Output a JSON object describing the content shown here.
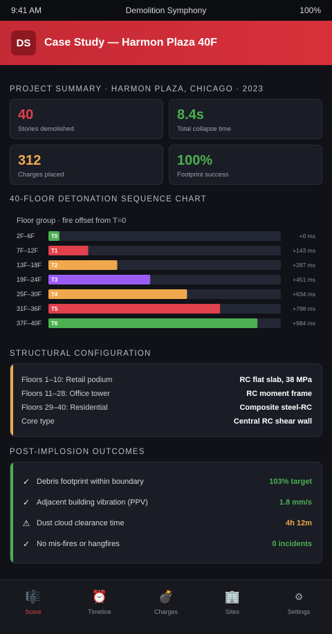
{
  "status": {
    "time": "9:41 AM",
    "app": "Demolition Symphony",
    "battery": "100%"
  },
  "header": {
    "badge": "DS",
    "title": "Case Study — Harmon Plaza 40F"
  },
  "summary": {
    "title": "PROJECT SUMMARY · HARMON PLAZA, CHICAGO · 2023",
    "stats": [
      {
        "value": "40",
        "label": "Stories demolished",
        "color": "#e0414c"
      },
      {
        "value": "8.4s",
        "label": "Total collapse time",
        "color": "#4caf50"
      },
      {
        "value": "312",
        "label": "Charges placed",
        "color": "#f0a84c"
      },
      {
        "value": "100%",
        "label": "Footprint success",
        "color": "#4caf50"
      }
    ]
  },
  "sequence": {
    "title": "40-FLOOR DETONATION SEQUENCE CHART",
    "subtitle": "Floor group · fire offset from T=0"
  },
  "chart_data": {
    "type": "bar",
    "title": "40-FLOOR DETONATION SEQUENCE CHART",
    "subtitle": "Floor group · fire offset from T=0",
    "categories": [
      "2F–6F",
      "7F–12F",
      "13F–18F",
      "19F–24F",
      "25F–30F",
      "31F–36F",
      "37F–40F"
    ],
    "tags": [
      "T0",
      "T1",
      "T2",
      "T3",
      "T4",
      "T5",
      "T6"
    ],
    "values": [
      0,
      143,
      287,
      451,
      634,
      798,
      984
    ],
    "value_labels": [
      "+0 ms",
      "+143 ms",
      "+287 ms",
      "+451 ms",
      "+634 ms",
      "+798 ms",
      "+984 ms"
    ],
    "colors": [
      "#4caf50",
      "#e0414c",
      "#f0a84c",
      "#9b5cf6",
      "#f0a84c",
      "#e0414c",
      "#4caf50"
    ],
    "track_color": "#232734"
  },
  "structure": {
    "title": "STRUCTURAL CONFIGURATION",
    "accent": "#f0a84c",
    "rows": [
      {
        "key": "Floors 1–10: Retail podium",
        "value": "RC flat slab, 38 MPa"
      },
      {
        "key": "Floors 11–28: Office tower",
        "value": "RC moment frame"
      },
      {
        "key": "Floors 29–40: Residential",
        "value": "Composite steel-RC"
      },
      {
        "key": "Core type",
        "value": "Central RC shear wall"
      }
    ]
  },
  "outcomes": {
    "title": "POST-IMPLOSION OUTCOMES",
    "accent": "#4caf50",
    "rows": [
      {
        "icon": "✓",
        "label": "Debris footprint within boundary",
        "value": "103% target",
        "color": "#4caf50"
      },
      {
        "icon": "✓",
        "label": "Adjacent building vibration (PPV)",
        "value": "1.8 mm/s",
        "color": "#4caf50"
      },
      {
        "icon": "⚠",
        "label": "Dust cloud clearance time",
        "value": "4h 12m",
        "color": "#f0a84c"
      },
      {
        "icon": "✓",
        "label": "No mis-fires or hangfires",
        "value": "0 incidents",
        "color": "#4caf50"
      }
    ]
  },
  "nav": [
    {
      "icon": "🎼",
      "label": "Score"
    },
    {
      "icon": "⏰",
      "label": "Timeline"
    },
    {
      "icon": "💣",
      "label": "Charges"
    },
    {
      "icon": "🏢",
      "label": "Sites"
    },
    {
      "icon": "⚙",
      "label": "Settings"
    }
  ]
}
